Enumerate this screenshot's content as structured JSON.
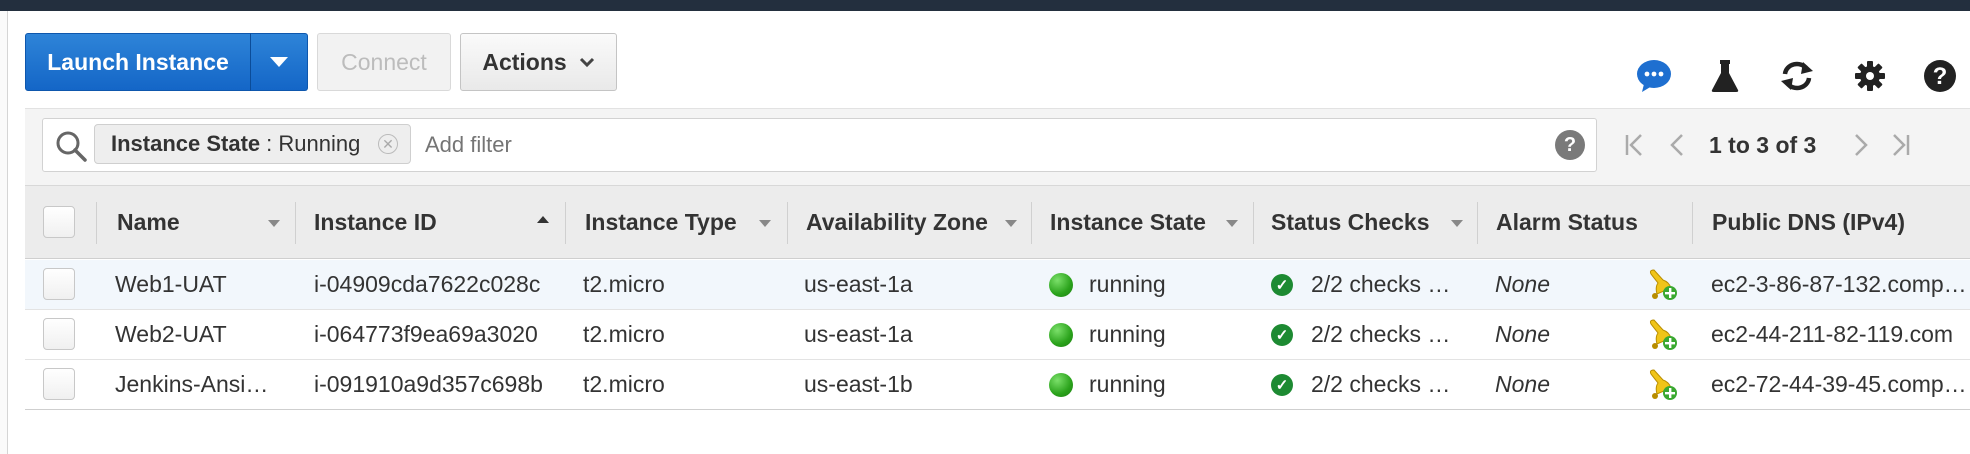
{
  "toolbar": {
    "launch_label": "Launch Instance",
    "connect_label": "Connect",
    "actions_label": "Actions"
  },
  "tools": [
    "feedback-icon",
    "experiment-icon",
    "refresh-icon",
    "settings-icon",
    "help-icon"
  ],
  "filter": {
    "chip_key": "Instance State",
    "chip_value": ": Running",
    "placeholder": "Add filter",
    "help": "?"
  },
  "pagination": {
    "text": "1 to 3 of 3"
  },
  "columns": {
    "name": "Name",
    "instance_id": "Instance ID",
    "instance_type": "Instance Type",
    "az": "Availability Zone",
    "state": "Instance State",
    "status": "Status Checks",
    "alarm": "Alarm Status",
    "dns": "Public DNS (IPv4)"
  },
  "rows": [
    {
      "name": "Web1-UAT",
      "instance_id": "i-04909cda7622c028c",
      "instance_type": "t2.micro",
      "az": "us-east-1a",
      "state": "running",
      "status": "2/2 checks …",
      "alarm": "None",
      "dns": "ec2-3-86-87-132.comp…"
    },
    {
      "name": "Web2-UAT",
      "instance_id": "i-064773f9ea69a3020",
      "instance_type": "t2.micro",
      "az": "us-east-1a",
      "state": "running",
      "status": "2/2 checks …",
      "alarm": "None",
      "dns": "ec2-44-211-82-119.com"
    },
    {
      "name": "Jenkins-Ansi…",
      "instance_id": "i-091910a9d357c698b",
      "instance_type": "t2.micro",
      "az": "us-east-1b",
      "state": "running",
      "status": "2/2 checks …",
      "alarm": "None",
      "dns": "ec2-72-44-39-45.comp…"
    }
  ],
  "colors": {
    "primary": "#1466c7",
    "running": "#2aa21b",
    "header_bg": "#ececec",
    "topbar": "#232f3e"
  }
}
